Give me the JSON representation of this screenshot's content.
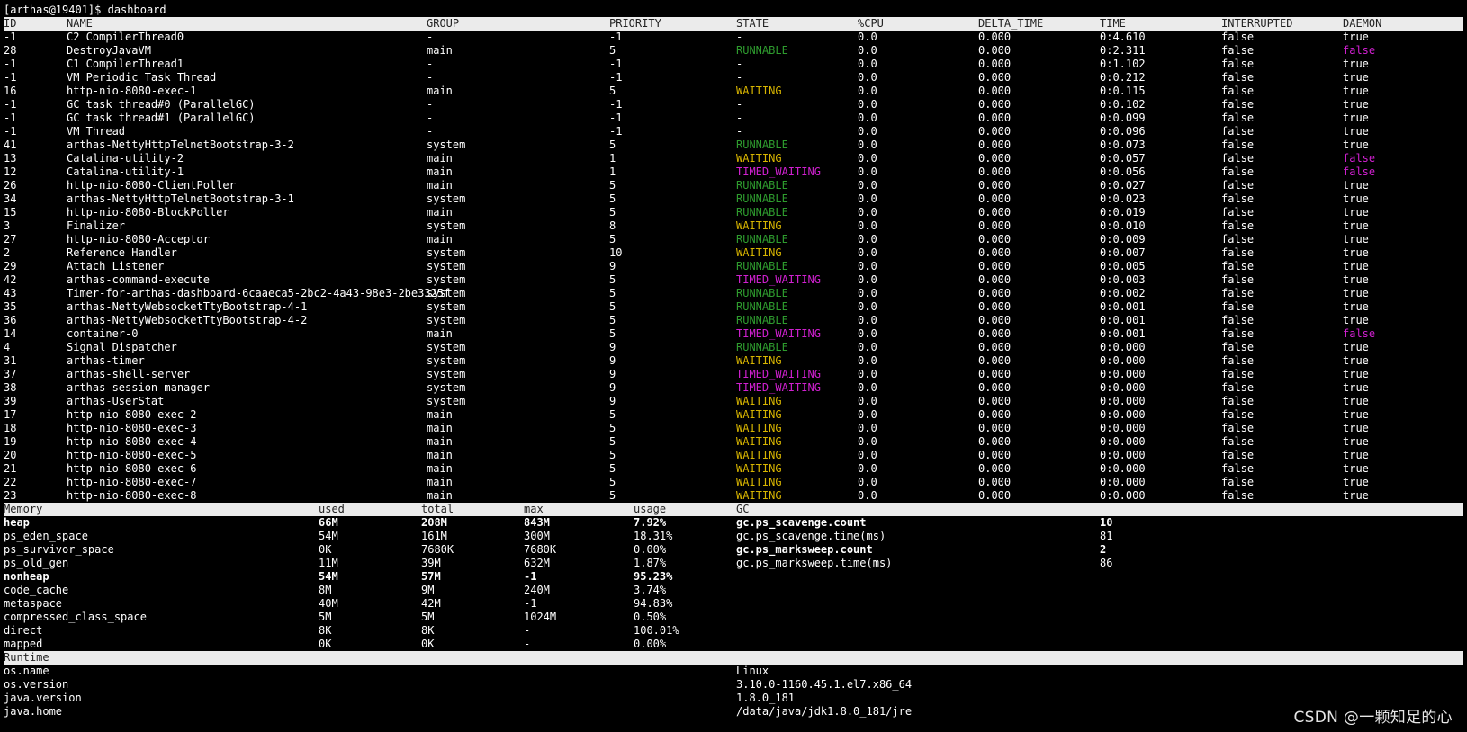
{
  "prompt": "[arthas@19401]$ dashboard",
  "threads": {
    "headers": {
      "id": "ID",
      "name": "NAME",
      "group": "GROUP",
      "priority": "PRIORITY",
      "state": "STATE",
      "cpu": "%CPU",
      "delta": "DELTA_TIME",
      "time": "TIME",
      "interrupted": "INTERRUPTED",
      "daemon": "DAEMON"
    },
    "rows": [
      [
        "-1",
        "C2 CompilerThread0",
        "-",
        "-1",
        "-",
        "0.0",
        "0.000",
        "0:4.610",
        "false",
        "true"
      ],
      [
        "28",
        "DestroyJavaVM",
        "main",
        "5",
        "RUNNABLE",
        "0.0",
        "0.000",
        "0:2.311",
        "false",
        "false"
      ],
      [
        "-1",
        "C1 CompilerThread1",
        "-",
        "-1",
        "-",
        "0.0",
        "0.000",
        "0:1.102",
        "false",
        "true"
      ],
      [
        "-1",
        "VM Periodic Task Thread",
        "-",
        "-1",
        "-",
        "0.0",
        "0.000",
        "0:0.212",
        "false",
        "true"
      ],
      [
        "16",
        "http-nio-8080-exec-1",
        "main",
        "5",
        "WAITING",
        "0.0",
        "0.000",
        "0:0.115",
        "false",
        "true"
      ],
      [
        "-1",
        "GC task thread#0 (ParallelGC)",
        "-",
        "-1",
        "-",
        "0.0",
        "0.000",
        "0:0.102",
        "false",
        "true"
      ],
      [
        "-1",
        "GC task thread#1 (ParallelGC)",
        "-",
        "-1",
        "-",
        "0.0",
        "0.000",
        "0:0.099",
        "false",
        "true"
      ],
      [
        "-1",
        "VM Thread",
        "-",
        "-1",
        "-",
        "0.0",
        "0.000",
        "0:0.096",
        "false",
        "true"
      ],
      [
        "41",
        "arthas-NettyHttpTelnetBootstrap-3-2",
        "system",
        "5",
        "RUNNABLE",
        "0.0",
        "0.000",
        "0:0.073",
        "false",
        "true"
      ],
      [
        "13",
        "Catalina-utility-2",
        "main",
        "1",
        "WAITING",
        "0.0",
        "0.000",
        "0:0.057",
        "false",
        "false"
      ],
      [
        "12",
        "Catalina-utility-1",
        "main",
        "1",
        "TIMED_WAITING",
        "0.0",
        "0.000",
        "0:0.056",
        "false",
        "false"
      ],
      [
        "26",
        "http-nio-8080-ClientPoller",
        "main",
        "5",
        "RUNNABLE",
        "0.0",
        "0.000",
        "0:0.027",
        "false",
        "true"
      ],
      [
        "34",
        "arthas-NettyHttpTelnetBootstrap-3-1",
        "system",
        "5",
        "RUNNABLE",
        "0.0",
        "0.000",
        "0:0.023",
        "false",
        "true"
      ],
      [
        "15",
        "http-nio-8080-BlockPoller",
        "main",
        "5",
        "RUNNABLE",
        "0.0",
        "0.000",
        "0:0.019",
        "false",
        "true"
      ],
      [
        "3",
        "Finalizer",
        "system",
        "8",
        "WAITING",
        "0.0",
        "0.000",
        "0:0.010",
        "false",
        "true"
      ],
      [
        "27",
        "http-nio-8080-Acceptor",
        "main",
        "5",
        "RUNNABLE",
        "0.0",
        "0.000",
        "0:0.009",
        "false",
        "true"
      ],
      [
        "2",
        "Reference Handler",
        "system",
        "10",
        "WAITING",
        "0.0",
        "0.000",
        "0:0.007",
        "false",
        "true"
      ],
      [
        "29",
        "Attach Listener",
        "system",
        "9",
        "RUNNABLE",
        "0.0",
        "0.000",
        "0:0.005",
        "false",
        "true"
      ],
      [
        "42",
        "arthas-command-execute",
        "system",
        "5",
        "TIMED_WAITING",
        "0.0",
        "0.000",
        "0:0.003",
        "false",
        "true"
      ],
      [
        "43",
        "Timer-for-arthas-dashboard-6caaeca5-2bc2-4a43-98e3-2be3325f",
        "system",
        "5",
        "RUNNABLE",
        "0.0",
        "0.000",
        "0:0.002",
        "false",
        "true"
      ],
      [
        "35",
        "arthas-NettyWebsocketTtyBootstrap-4-1",
        "system",
        "5",
        "RUNNABLE",
        "0.0",
        "0.000",
        "0:0.001",
        "false",
        "true"
      ],
      [
        "36",
        "arthas-NettyWebsocketTtyBootstrap-4-2",
        "system",
        "5",
        "RUNNABLE",
        "0.0",
        "0.000",
        "0:0.001",
        "false",
        "true"
      ],
      [
        "14",
        "container-0",
        "main",
        "5",
        "TIMED_WAITING",
        "0.0",
        "0.000",
        "0:0.001",
        "false",
        "false"
      ],
      [
        "4",
        "Signal Dispatcher",
        "system",
        "9",
        "RUNNABLE",
        "0.0",
        "0.000",
        "0:0.000",
        "false",
        "true"
      ],
      [
        "31",
        "arthas-timer",
        "system",
        "9",
        "WAITING",
        "0.0",
        "0.000",
        "0:0.000",
        "false",
        "true"
      ],
      [
        "37",
        "arthas-shell-server",
        "system",
        "9",
        "TIMED_WAITING",
        "0.0",
        "0.000",
        "0:0.000",
        "false",
        "true"
      ],
      [
        "38",
        "arthas-session-manager",
        "system",
        "9",
        "TIMED_WAITING",
        "0.0",
        "0.000",
        "0:0.000",
        "false",
        "true"
      ],
      [
        "39",
        "arthas-UserStat",
        "system",
        "9",
        "WAITING",
        "0.0",
        "0.000",
        "0:0.000",
        "false",
        "true"
      ],
      [
        "17",
        "http-nio-8080-exec-2",
        "main",
        "5",
        "WAITING",
        "0.0",
        "0.000",
        "0:0.000",
        "false",
        "true"
      ],
      [
        "18",
        "http-nio-8080-exec-3",
        "main",
        "5",
        "WAITING",
        "0.0",
        "0.000",
        "0:0.000",
        "false",
        "true"
      ],
      [
        "19",
        "http-nio-8080-exec-4",
        "main",
        "5",
        "WAITING",
        "0.0",
        "0.000",
        "0:0.000",
        "false",
        "true"
      ],
      [
        "20",
        "http-nio-8080-exec-5",
        "main",
        "5",
        "WAITING",
        "0.0",
        "0.000",
        "0:0.000",
        "false",
        "true"
      ],
      [
        "21",
        "http-nio-8080-exec-6",
        "main",
        "5",
        "WAITING",
        "0.0",
        "0.000",
        "0:0.000",
        "false",
        "true"
      ],
      [
        "22",
        "http-nio-8080-exec-7",
        "main",
        "5",
        "WAITING",
        "0.0",
        "0.000",
        "0:0.000",
        "false",
        "true"
      ],
      [
        "23",
        "http-nio-8080-exec-8",
        "main",
        "5",
        "WAITING",
        "0.0",
        "0.000",
        "0:0.000",
        "false",
        "true"
      ]
    ]
  },
  "memory": {
    "headers": {
      "memory": "Memory",
      "used": "used",
      "total": "total",
      "max": "max",
      "usage": "usage",
      "gc": "GC"
    },
    "rows": [
      {
        "name": "heap",
        "used": "66M",
        "total": "208M",
        "max": "843M",
        "usage": "7.92%",
        "bold": true
      },
      {
        "name": "ps_eden_space",
        "used": "54M",
        "total": "161M",
        "max": "300M",
        "usage": "18.31%",
        "bold": false
      },
      {
        "name": "ps_survivor_space",
        "used": "0K",
        "total": "7680K",
        "max": "7680K",
        "usage": "0.00%",
        "bold": false
      },
      {
        "name": "ps_old_gen",
        "used": "11M",
        "total": "39M",
        "max": "632M",
        "usage": "1.87%",
        "bold": false
      },
      {
        "name": "nonheap",
        "used": "54M",
        "total": "57M",
        "max": "-1",
        "usage": "95.23%",
        "bold": true
      },
      {
        "name": "code_cache",
        "used": "8M",
        "total": "9M",
        "max": "240M",
        "usage": "3.74%",
        "bold": false
      },
      {
        "name": "metaspace",
        "used": "40M",
        "total": "42M",
        "max": "-1",
        "usage": "94.83%",
        "bold": false
      },
      {
        "name": "compressed_class_space",
        "used": "5M",
        "total": "5M",
        "max": "1024M",
        "usage": "0.50%",
        "bold": false
      },
      {
        "name": "direct",
        "used": "8K",
        "total": "8K",
        "max": "-",
        "usage": "100.01%",
        "bold": false
      },
      {
        "name": "mapped",
        "used": "0K",
        "total": "0K",
        "max": "-",
        "usage": "0.00%",
        "bold": false
      }
    ],
    "gc": [
      {
        "name": "gc.ps_scavenge.count",
        "value": "10",
        "bold": true
      },
      {
        "name": "gc.ps_scavenge.time(ms)",
        "value": "81",
        "bold": false
      },
      {
        "name": "gc.ps_marksweep.count",
        "value": "2",
        "bold": true
      },
      {
        "name": "gc.ps_marksweep.time(ms)",
        "value": "86",
        "bold": false
      }
    ]
  },
  "runtime": {
    "header": "Runtime",
    "rows": [
      {
        "key": "os.name",
        "value": "Linux"
      },
      {
        "key": "os.version",
        "value": "3.10.0-1160.45.1.el7.x86_64"
      },
      {
        "key": "java.version",
        "value": "1.8.0_181"
      },
      {
        "key": "java.home",
        "value": "/data/java/jdk1.8.0_181/jre"
      }
    ]
  },
  "watermark": "CSDN @一颗知足的心",
  "colors": {
    "runnable": "#2e9b2e",
    "waiting": "#d7b400",
    "timed_waiting": "#d020d0",
    "daemon_false": "#d020d0",
    "header_bg": "#ebebeb"
  }
}
